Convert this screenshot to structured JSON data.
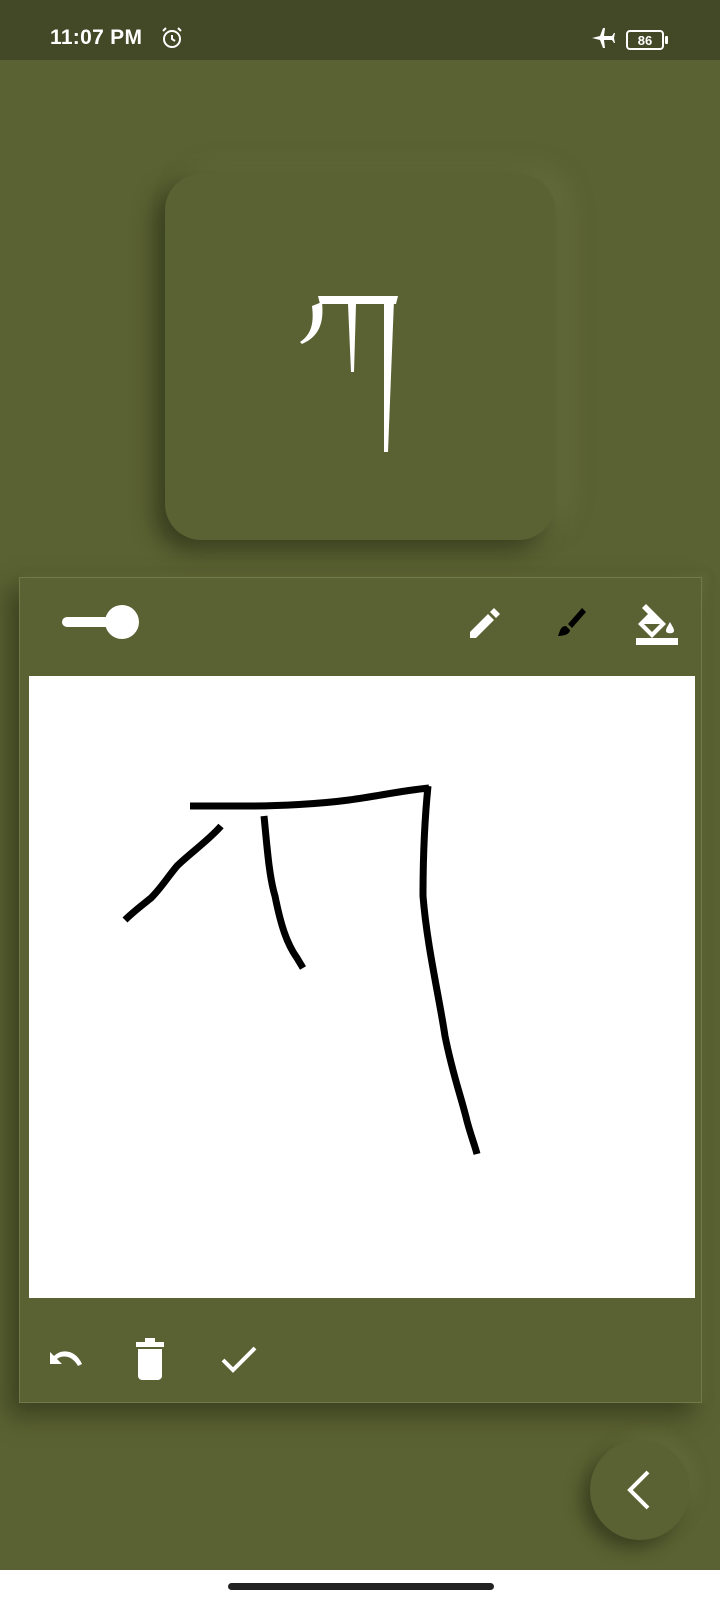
{
  "status_bar": {
    "time": "11:07 PM",
    "battery_level": "86",
    "icons": [
      "alarm-icon",
      "airplane-mode-icon",
      "battery-icon"
    ]
  },
  "letter_card": {
    "icon": "tibetan-letter-ga"
  },
  "drawing_panel": {
    "top_tools": [
      "stroke-size-slider",
      "pencil-icon",
      "brush-icon",
      "fill-bucket-icon"
    ],
    "bottom_tools": [
      "undo-icon",
      "trash-icon",
      "check-icon"
    ]
  },
  "navigation": {
    "back_icon": "chevron-left-icon"
  },
  "colors": {
    "background": "#5a6132",
    "status_bar": "#434826",
    "canvas": "#ffffff",
    "ink": "#000000",
    "icon": "#ffffff"
  }
}
